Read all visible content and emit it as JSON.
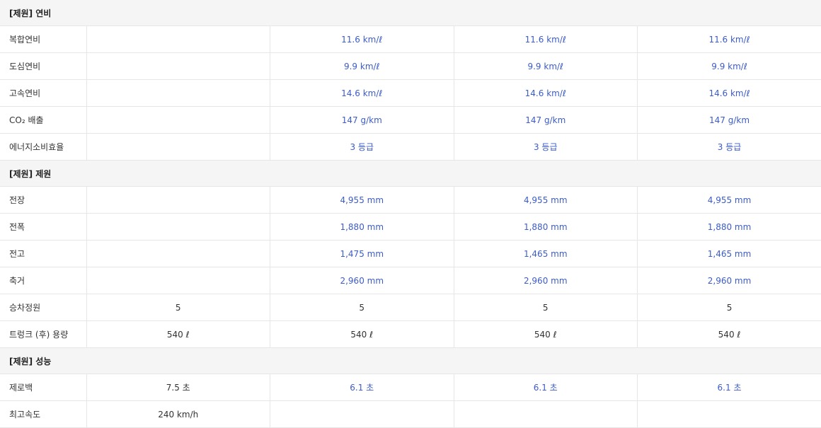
{
  "sections": [
    {
      "title": "[제원] 연비",
      "rows": [
        {
          "label": "복합연비",
          "values": [
            "",
            "11.6 km/ℓ",
            "11.6 km/ℓ",
            "11.6 km/ℓ"
          ],
          "highlight": [
            false,
            true,
            true,
            true
          ]
        },
        {
          "label": "도심연비",
          "values": [
            "",
            "9.9 km/ℓ",
            "9.9 km/ℓ",
            "9.9 km/ℓ"
          ],
          "highlight": [
            false,
            true,
            true,
            true
          ]
        },
        {
          "label": "고속연비",
          "values": [
            "",
            "14.6 km/ℓ",
            "14.6 km/ℓ",
            "14.6 km/ℓ"
          ],
          "highlight": [
            false,
            true,
            true,
            true
          ]
        },
        {
          "label": "CO₂ 배출",
          "values": [
            "",
            "147 g/km",
            "147 g/km",
            "147 g/km"
          ],
          "highlight": [
            false,
            true,
            true,
            true
          ]
        },
        {
          "label": "에너지소비효율",
          "values": [
            "",
            "3 등급",
            "3 등급",
            "3 등급"
          ],
          "highlight": [
            false,
            true,
            true,
            true
          ]
        }
      ]
    },
    {
      "title": "[제원] 제원",
      "rows": [
        {
          "label": "전장",
          "values": [
            "",
            "4,955 mm",
            "4,955 mm",
            "4,955 mm"
          ],
          "highlight": [
            false,
            true,
            true,
            true
          ]
        },
        {
          "label": "전폭",
          "values": [
            "",
            "1,880 mm",
            "1,880 mm",
            "1,880 mm"
          ],
          "highlight": [
            false,
            true,
            true,
            true
          ]
        },
        {
          "label": "전고",
          "values": [
            "",
            "1,475 mm",
            "1,465 mm",
            "1,465 mm"
          ],
          "highlight": [
            false,
            true,
            true,
            true
          ]
        },
        {
          "label": "축거",
          "values": [
            "",
            "2,960 mm",
            "2,960 mm",
            "2,960 mm"
          ],
          "highlight": [
            false,
            true,
            true,
            true
          ]
        },
        {
          "label": "승차정원",
          "values": [
            "5",
            "5",
            "5",
            "5"
          ],
          "highlight": [
            false,
            false,
            false,
            false
          ]
        },
        {
          "label": "트렁크 (후) 용량",
          "values": [
            "540 ℓ",
            "540 ℓ",
            "540 ℓ",
            "540 ℓ"
          ],
          "highlight": [
            false,
            false,
            false,
            false
          ]
        }
      ]
    },
    {
      "title": "[제원] 성능",
      "rows": [
        {
          "label": "제로백",
          "values": [
            "7.5 초",
            "6.1 초",
            "6.1 초",
            "6.1 초"
          ],
          "highlight": [
            false,
            true,
            true,
            true
          ]
        },
        {
          "label": "최고속도",
          "values": [
            "240 km/h",
            "",
            "",
            ""
          ],
          "highlight": [
            false,
            false,
            false,
            false
          ]
        }
      ]
    }
  ],
  "colors": {
    "highlight": "#3c5cc7",
    "section_bg": "#f5f5f5",
    "border": "#e6e6e6"
  }
}
